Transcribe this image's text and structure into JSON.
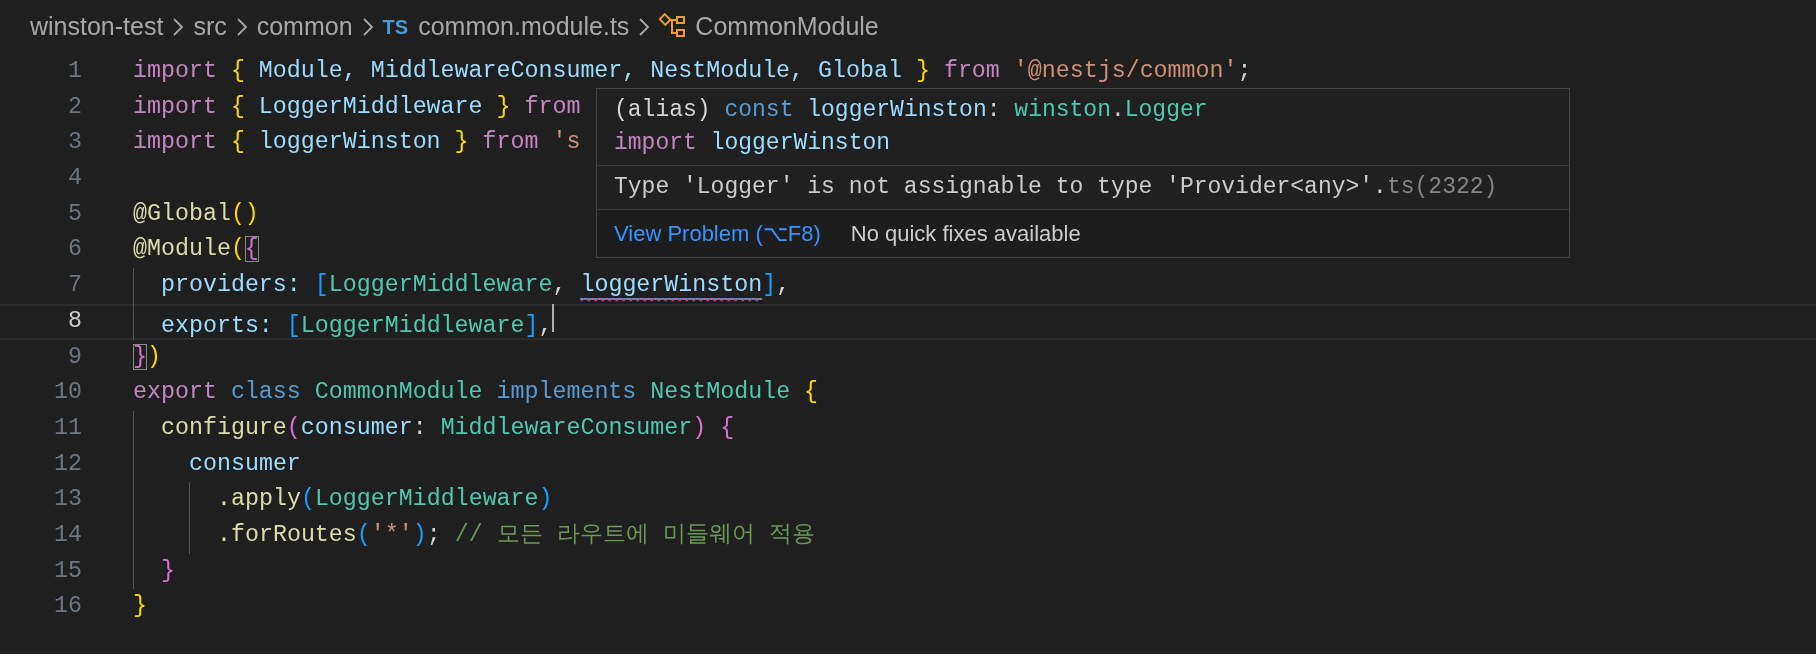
{
  "breadcrumb": [
    {
      "label": "winston-test",
      "kind": "folder"
    },
    {
      "label": "src",
      "kind": "folder"
    },
    {
      "label": "common",
      "kind": "folder"
    },
    {
      "label": "common.module.ts",
      "kind": "file",
      "badge": "TS"
    },
    {
      "label": "CommonModule",
      "kind": "symbol"
    }
  ],
  "editor": {
    "lines": [
      {
        "number": "1",
        "current": false,
        "tokens": [
          {
            "t": "import",
            "kind": "kw"
          },
          {
            "t": "{",
            "kind": "brace",
            "sp": true
          },
          {
            "t": "Module, MiddlewareConsumer, NestModule, Global",
            "kind": "id",
            "sp": true
          },
          {
            "t": "}",
            "kind": "brace",
            "sp": true
          },
          {
            "t": "from",
            "kind": "kw",
            "sp": true
          },
          {
            "t": "'@nestjs/common'",
            "kind": "str",
            "sp": true
          },
          {
            "t": ";",
            "kind": "plain"
          }
        ]
      },
      {
        "number": "2",
        "current": false,
        "tokens": [
          {
            "t": "import",
            "kind": "kw"
          },
          {
            "t": "{",
            "kind": "brace",
            "sp": true
          },
          {
            "t": "LoggerMiddleware",
            "kind": "id",
            "sp": true
          },
          {
            "t": "}",
            "kind": "brace",
            "sp": true
          },
          {
            "t": "from",
            "kind": "kw",
            "sp": true
          }
        ]
      },
      {
        "number": "3",
        "current": false,
        "tokens": [
          {
            "t": "import",
            "kind": "kw"
          },
          {
            "t": "{",
            "kind": "brace",
            "sp": true
          },
          {
            "t": "loggerWinston",
            "kind": "id",
            "sp": true
          },
          {
            "t": "}",
            "kind": "brace",
            "sp": true
          },
          {
            "t": "from",
            "kind": "kw",
            "sp": true
          },
          {
            "t": "'s",
            "kind": "str",
            "sp": true
          }
        ]
      },
      {
        "number": "4",
        "current": false
      },
      {
        "number": "5",
        "current": false,
        "tokens": [
          {
            "t": "@Global",
            "kind": "func"
          },
          {
            "t": "()",
            "kind": "brace"
          }
        ]
      },
      {
        "number": "6",
        "current": false,
        "tokens": [
          {
            "t": "@Module",
            "kind": "func"
          },
          {
            "t": "(",
            "kind": "brace"
          },
          {
            "t": "{",
            "kind": "bracket2",
            "matched": true
          }
        ]
      },
      {
        "number": "7",
        "current": false,
        "tokens": [
          {
            "kind": "indent",
            "guide": true
          },
          {
            "t": "providers:",
            "kind": "id"
          },
          {
            "t": "[",
            "kind": "bracket3",
            "sp": true
          },
          {
            "t": "LoggerMiddleware",
            "kind": "type"
          },
          {
            "t": ",",
            "kind": "plain"
          },
          {
            "t": "loggerWinston",
            "kind": "id",
            "sp": true,
            "error": true
          },
          {
            "t": "]",
            "kind": "bracket3"
          },
          {
            "t": ",",
            "kind": "plain"
          }
        ]
      },
      {
        "number": "8",
        "current": true,
        "cursor": true,
        "tokens": [
          {
            "kind": "indent",
            "guide": true
          },
          {
            "t": "exports:",
            "kind": "id"
          },
          {
            "t": "[",
            "kind": "bracket3",
            "sp": true
          },
          {
            "t": "LoggerMiddleware",
            "kind": "type"
          },
          {
            "t": "]",
            "kind": "bracket3"
          },
          {
            "t": ",",
            "kind": "plain"
          }
        ]
      },
      {
        "number": "9",
        "current": false,
        "tokens": [
          {
            "t": "}",
            "kind": "bracket2",
            "matched": true
          },
          {
            "t": ")",
            "kind": "brace"
          }
        ]
      },
      {
        "number": "10",
        "current": false,
        "tokens": [
          {
            "t": "export",
            "kind": "kw"
          },
          {
            "t": "class",
            "kind": "storage",
            "sp": true
          },
          {
            "t": "CommonModule",
            "kind": "type",
            "sp": true
          },
          {
            "t": "implements",
            "kind": "storage",
            "sp": true
          },
          {
            "t": "NestModule",
            "kind": "type",
            "sp": true
          },
          {
            "t": "{",
            "kind": "brace",
            "sp": true
          }
        ]
      },
      {
        "number": "11",
        "current": false,
        "tokens": [
          {
            "kind": "indent",
            "guide": true
          },
          {
            "t": "configure",
            "kind": "func"
          },
          {
            "t": "(",
            "kind": "bracket2"
          },
          {
            "t": "consumer",
            "kind": "id"
          },
          {
            "t": ":",
            "kind": "plain"
          },
          {
            "t": "MiddlewareConsumer",
            "kind": "type",
            "sp": true
          },
          {
            "t": ")",
            "kind": "bracket2"
          },
          {
            "t": "{",
            "kind": "bracket2",
            "sp": true
          }
        ]
      },
      {
        "number": "12",
        "current": false,
        "tokens": [
          {
            "kind": "indent",
            "guide": true
          },
          {
            "kind": "indent",
            "guide": false
          },
          {
            "t": "consumer",
            "kind": "id"
          }
        ]
      },
      {
        "number": "13",
        "current": false,
        "tokens": [
          {
            "kind": "indent",
            "guide": true
          },
          {
            "kind": "indent",
            "guide": false
          },
          {
            "kind": "indent",
            "guide": true
          },
          {
            "t": ".apply",
            "kind": "func"
          },
          {
            "t": "(",
            "kind": "bracket3"
          },
          {
            "t": "LoggerMiddleware",
            "kind": "type"
          },
          {
            "t": ")",
            "kind": "bracket3"
          }
        ]
      },
      {
        "number": "14",
        "current": false,
        "tokens": [
          {
            "kind": "indent",
            "guide": true
          },
          {
            "kind": "indent",
            "guide": false
          },
          {
            "kind": "indent",
            "guide": true
          },
          {
            "t": ".forRoutes",
            "kind": "func"
          },
          {
            "t": "(",
            "kind": "bracket3"
          },
          {
            "t": "'*'",
            "kind": "str"
          },
          {
            "t": ")",
            "kind": "bracket3"
          },
          {
            "t": ";",
            "kind": "plain"
          },
          {
            "t": "// 모든 라우트에 미들웨어 적용",
            "kind": "comment",
            "sp": true
          }
        ]
      },
      {
        "number": "15",
        "current": false,
        "tokens": [
          {
            "kind": "indent",
            "guide": true
          },
          {
            "t": "}",
            "kind": "bracket2"
          }
        ]
      },
      {
        "number": "16",
        "current": false,
        "tokens": [
          {
            "t": "}",
            "kind": "brace"
          }
        ]
      }
    ]
  },
  "hover": {
    "signature": [
      {
        "t": "(alias)",
        "kind": "plain"
      },
      {
        "t": "const",
        "kind": "storage",
        "sp": true
      },
      {
        "t": "loggerWinston",
        "kind": "id",
        "sp": true
      },
      {
        "t": ":",
        "kind": "plain"
      },
      {
        "t": "winston",
        "kind": "type",
        "sp": true
      },
      {
        "t": ".",
        "kind": "plain"
      },
      {
        "t": "Logger",
        "kind": "type"
      }
    ],
    "import_line": [
      {
        "t": "import",
        "kind": "kw"
      },
      {
        "t": "loggerWinston",
        "kind": "id",
        "sp": true
      }
    ],
    "message": "Type 'Logger' is not assignable to type 'Provider<any>'.",
    "code": "ts(2322)",
    "actions": [
      {
        "label": "View Problem (⌥F8)",
        "kind": "link"
      },
      {
        "label": "No quick fixes available",
        "kind": "note"
      }
    ]
  }
}
